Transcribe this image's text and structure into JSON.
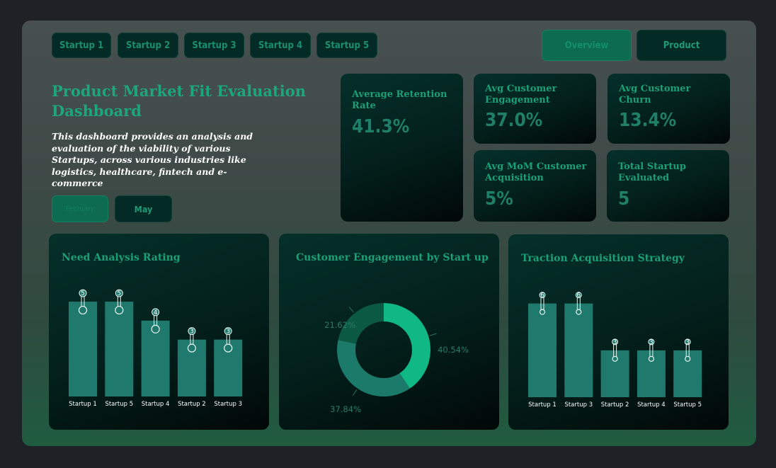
{
  "startup_tabs": [
    "Startup 1",
    "Startup 2",
    "Startup 3",
    "Startup 4",
    "Startup 5"
  ],
  "view_tabs": {
    "overview": "Overview",
    "product": "Product",
    "active": "Overview"
  },
  "header": {
    "title": "Product Market Fit Evaluation Dashboard",
    "description": "This dashboard provides an analysis and evaluation of the viability of various Startups, across various industries like logistics, healthcare, fintech and e-commerce"
  },
  "month_filter": {
    "items": [
      "February",
      "May"
    ],
    "active": "February"
  },
  "kpis": {
    "retention": {
      "label": "Average Retention Rate",
      "value": "41.3%"
    },
    "engagement": {
      "label": "Avg Customer Engagement",
      "value": "37.0%"
    },
    "churn": {
      "label": "Avg Customer Churn",
      "value": "13.4%"
    },
    "acquisition": {
      "label": "Avg MoM Customer Acquisition",
      "value": "5%"
    },
    "total": {
      "label": "Total Startup Evaluated",
      "value": "5"
    }
  },
  "colors": {
    "accent": "#1aa076",
    "bar": "#1f7a6d",
    "donut": [
      "#10b886",
      "#1c7a6b",
      "#0c5a44"
    ]
  },
  "chart_data": [
    {
      "type": "bar",
      "title": "Need Analysis Rating",
      "categories": [
        "Startup 1",
        "Startup 5",
        "Startup 4",
        "Startup 2",
        "Startup 3"
      ],
      "values": [
        5,
        5,
        4,
        3,
        3
      ],
      "ylim": [
        0,
        5.6
      ]
    },
    {
      "type": "pie",
      "title": "Customer Engagement by Start up",
      "values": [
        40.54,
        37.84,
        21.62
      ],
      "labels": [
        "40.54%",
        "37.84%",
        "21.62%"
      ]
    },
    {
      "type": "bar",
      "title": "Traction Acquisition Strategy",
      "categories": [
        "Startup 1",
        "Startup 3",
        "Startup 2",
        "Startup 4",
        "Startup 5"
      ],
      "values": [
        6,
        6,
        3,
        3,
        3
      ],
      "ylim": [
        0,
        6.8
      ]
    }
  ]
}
